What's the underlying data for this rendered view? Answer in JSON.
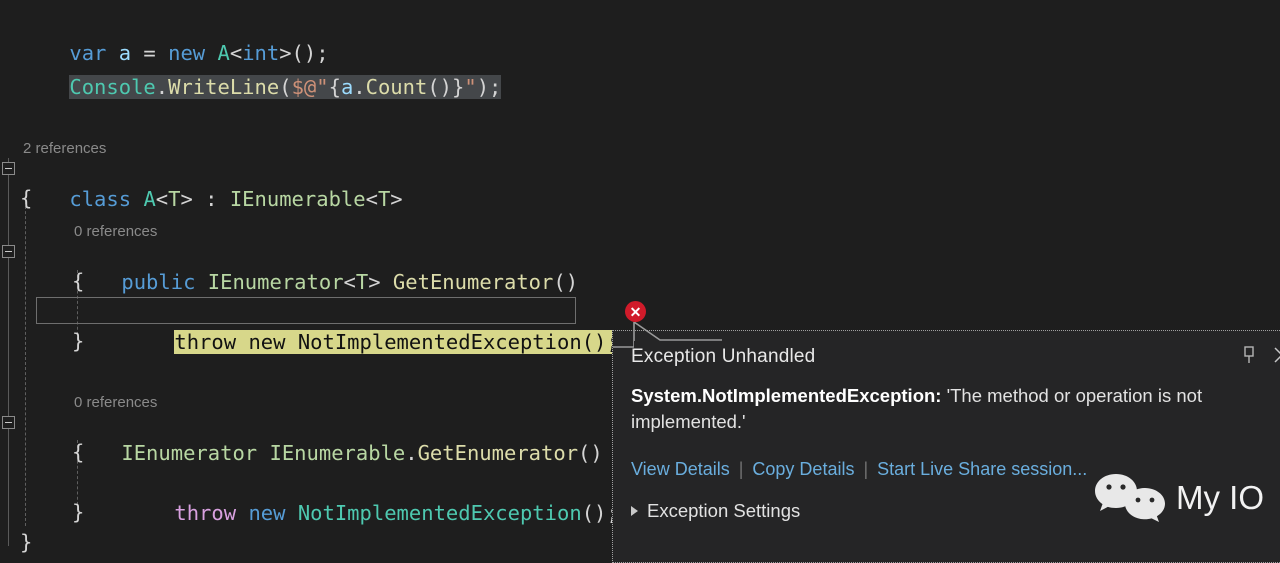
{
  "editor": {
    "background": "#1e1e1e",
    "lines": [
      {
        "id": "line-1",
        "text": "var a = new A<int>();"
      },
      {
        "id": "line-2",
        "text": "Console.WriteLine($@\"{a.Count()}\");",
        "selected": true
      },
      {
        "id": "line-3",
        "text": ""
      },
      {
        "id": "line-4",
        "text": ""
      },
      {
        "id": "line-5",
        "text": "2 references",
        "kind": "codelens"
      },
      {
        "id": "line-6",
        "text": "class A<T> : IEnumerable<T>"
      },
      {
        "id": "line-7",
        "text": "{"
      },
      {
        "id": "line-8",
        "text": "0 references",
        "kind": "codelens"
      },
      {
        "id": "line-9",
        "text": "public IEnumerator<T> GetEnumerator()"
      },
      {
        "id": "line-10",
        "text": "{"
      },
      {
        "id": "line-11",
        "text": "throw new NotImplementedException();",
        "current": true
      },
      {
        "id": "line-12",
        "text": "}"
      },
      {
        "id": "line-13",
        "text": ""
      },
      {
        "id": "line-14",
        "text": "0 references",
        "kind": "codelens"
      },
      {
        "id": "line-15",
        "text": "IEnumerator IEnumerable.GetEnumerator()"
      },
      {
        "id": "line-16",
        "text": "{"
      },
      {
        "id": "line-17",
        "text": "throw new NotImplementedException();"
      },
      {
        "id": "line-18",
        "text": "}"
      },
      {
        "id": "line-19",
        "text": "}"
      }
    ],
    "codelens": {
      "class_refs": "2 references",
      "method1_refs": "0 references",
      "method2_refs": "0 references"
    },
    "tokens": {
      "var": "var",
      "a": "a",
      "eq": " = ",
      "new": "new",
      "A": "A",
      "lt": "<",
      "int": "int",
      "gtparen": ">();",
      "Console": "Console",
      "dot": ".",
      "WriteLine": "WriteLine",
      "openparen": "(",
      "interp_prefix": "$@\"",
      "brace_open": "{",
      "a2": "a",
      "Count": "Count",
      "call": "()",
      "brace_close": "}",
      "quote": "\"",
      "closeparen": ");",
      "class": "class",
      "T": "T",
      "colon": " : ",
      "IEnumerable": "IEnumerable",
      "brace": "{",
      "brace_end": "}",
      "public": "public",
      "IEnumerator": "IEnumerator",
      "GetEnumerator": "GetEnumerator",
      "parens": "()",
      "throw": "throw",
      "NotImplementedException": "NotImplementedException",
      "semi": "();"
    },
    "colors": {
      "keyword": "#569cd6",
      "control": "#d8a0df",
      "type": "#4ec9b0",
      "interface": "#b8d7a3",
      "method": "#dcdcaa",
      "string": "#ce9178",
      "identifier": "#9cdcfe",
      "plain": "#d4d4d4",
      "codelens": "#8a8a8a",
      "selection": "#44474a",
      "current_line_highlight": "#d7d78a"
    }
  },
  "error_marker": {
    "icon": "error-x-icon",
    "glyph": "✕",
    "color": "#d01b2a"
  },
  "popup": {
    "title": "Exception Unhandled",
    "exception_type": "System.NotImplementedException:",
    "exception_message": "'The method or operation is not implemented.'",
    "links": [
      {
        "id": "view-details",
        "label": "View Details"
      },
      {
        "id": "copy-details",
        "label": "Copy Details"
      },
      {
        "id": "start-live-share",
        "label": "Start Live Share session..."
      }
    ],
    "separator": "|",
    "settings_label": "Exception Settings",
    "pin_icon": "pin-icon",
    "close_icon": "close-icon",
    "expand_icon": "chevron-right-icon"
  },
  "watermark": {
    "label": "My IO",
    "icon": "wechat-logo-icon"
  }
}
